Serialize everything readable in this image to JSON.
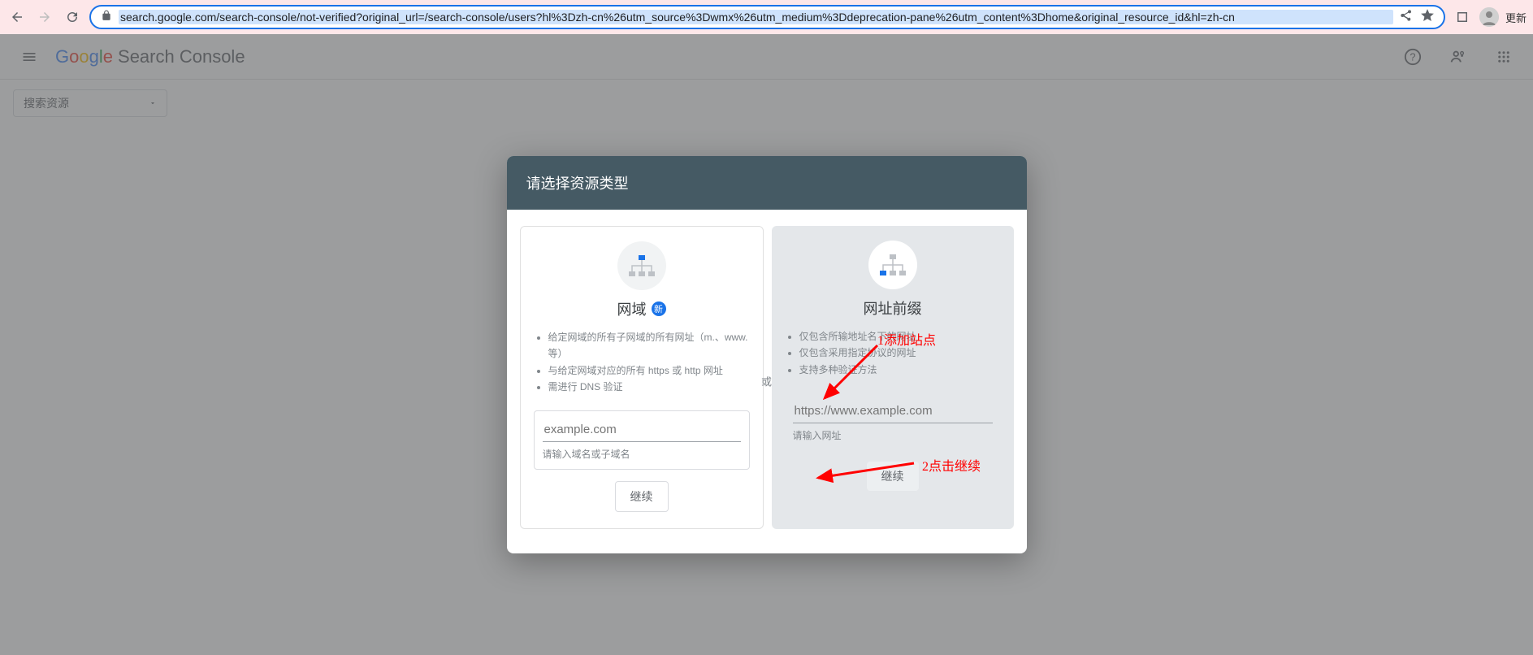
{
  "browser": {
    "url": "search.google.com/search-console/not-verified?original_url=/search-console/users?hl%3Dzh-cn%26utm_source%3Dwmx%26utm_medium%3Ddeprecation-pane%26utm_content%3Dhome&original_resource_id&hl=zh-cn",
    "more_label": "更新"
  },
  "header": {
    "product": "Search Console"
  },
  "resource_select": {
    "label": "搜索资源"
  },
  "dialog": {
    "title": "请选择资源类型",
    "or": "或",
    "domain_card": {
      "title": "网域",
      "badge": "新",
      "bullets": [
        "给定网域的所有子网域的所有网址（m.、www. 等）",
        "与给定网域对应的所有 https 或 http 网址",
        "需进行 DNS 验证"
      ],
      "placeholder": "example.com",
      "hint": "请输入域名或子域名",
      "button": "继续"
    },
    "url_card": {
      "title": "网址前缀",
      "bullets": [
        "仅包含所输地址名下的网址",
        "仅包含采用指定协议的网址",
        "支持多种验证方法"
      ],
      "placeholder": "https://www.example.com",
      "hint": "请输入网址",
      "button": "继续"
    }
  },
  "annotations": {
    "a1": "1添加站点",
    "a2": "2点击继续"
  }
}
